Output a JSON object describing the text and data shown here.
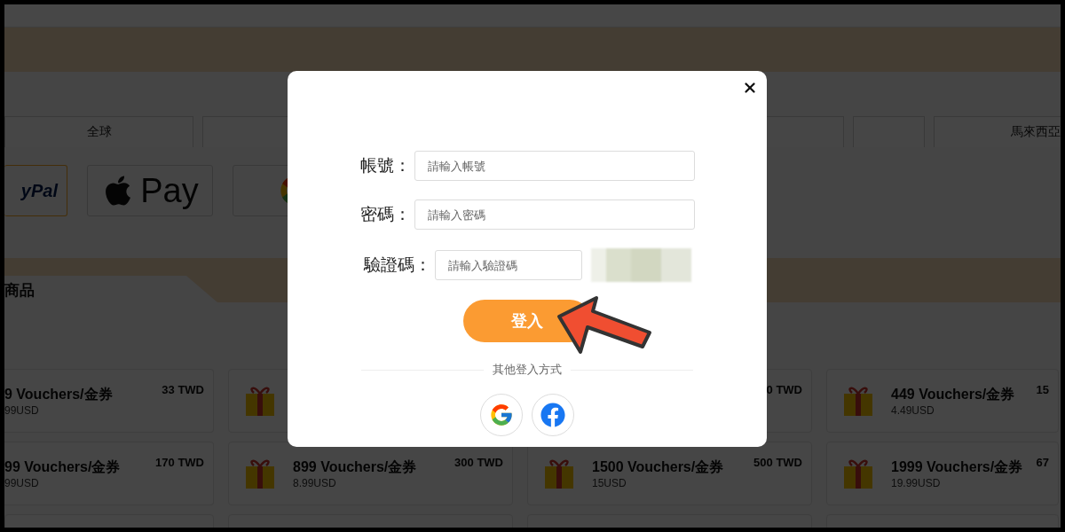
{
  "region_tabs": [
    "全球",
    "馬來西亞"
  ],
  "payment_methods": [
    {
      "kind": "paypal",
      "label": "yPal",
      "selected": true
    },
    {
      "kind": "applepay",
      "label": "Pay",
      "selected": false
    },
    {
      "kind": "google",
      "selected": false
    }
  ],
  "products_section": {
    "title": "商品"
  },
  "products": [
    {
      "kind": "cut",
      "gift": false,
      "title": "9 Vouchers/金券",
      "usd": "99USD",
      "twd": "33 TWD"
    },
    {
      "kind": "full",
      "gift": true
    },
    {
      "kind": "full",
      "twd": "0 TWD"
    },
    {
      "kind": "full",
      "gift": true,
      "title": "449 Vouchers/金券",
      "usd": "4.49USD",
      "twd": "15"
    },
    {
      "kind": "cut",
      "gift": false,
      "title": "99 Vouchers/金券",
      "usd": "99USD",
      "twd": "170 TWD"
    },
    {
      "kind": "full",
      "gift": true,
      "title": "899 Vouchers/金券",
      "usd": "8.99USD",
      "twd": "300 TWD"
    },
    {
      "kind": "full",
      "gift": true,
      "title": "1500 Vouchers/金券",
      "usd": "15USD",
      "twd": "500 TWD"
    },
    {
      "kind": "full",
      "gift": true,
      "title": "1999 Vouchers/金券",
      "usd": "19.99USD",
      "twd": "67"
    },
    {
      "kind": "empty"
    },
    {
      "kind": "empty"
    },
    {
      "kind": "empty"
    },
    {
      "kind": "empty"
    }
  ],
  "login_dialog": {
    "fields": [
      {
        "label": "帳號：",
        "placeholder": "請輸入帳號",
        "kind": "text"
      },
      {
        "label": "密碼：",
        "placeholder": "請輸入密碼",
        "kind": "password"
      },
      {
        "label": "驗證碼：",
        "placeholder": "請輸入驗證碼",
        "kind": "captcha"
      }
    ],
    "login_button": "登入",
    "other_methods": "其他登入方式",
    "social": [
      {
        "kind": "google"
      },
      {
        "kind": "facebook"
      }
    ]
  }
}
